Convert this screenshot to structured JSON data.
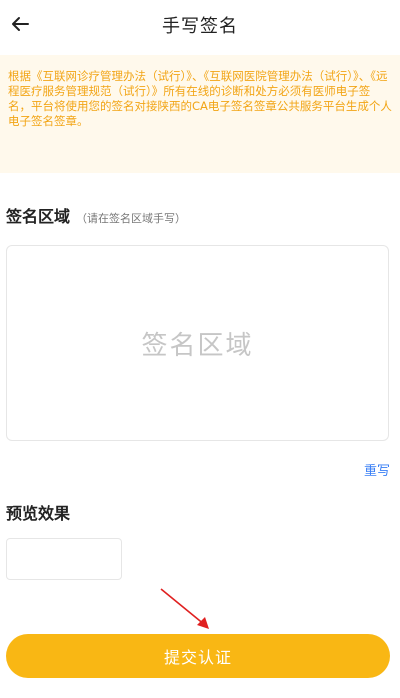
{
  "header": {
    "title": "手写签名",
    "back_icon": "arrow-left-icon"
  },
  "notice": {
    "text": "根据《互联网诊疗管理办法（试行）》、《互联网医院管理办法（试行）》、《远程医疗服务管理规范（试行）》所有在线的诊断和处方必须有医师电子签名，平台将使用您的签名对接陕西的CA电子签名签章公共服务平台生成个人电子签名签章。",
    "color": "#f2a516"
  },
  "signature": {
    "label": "签名区域",
    "hint": "（请在签名区域手写）",
    "placeholder": "签名区域",
    "rewrite_label": "重写"
  },
  "preview": {
    "label": "预览效果"
  },
  "submit": {
    "label": "提交认证",
    "color": "#f9b714"
  },
  "annotation": {
    "arrow_color": "#e02020"
  }
}
